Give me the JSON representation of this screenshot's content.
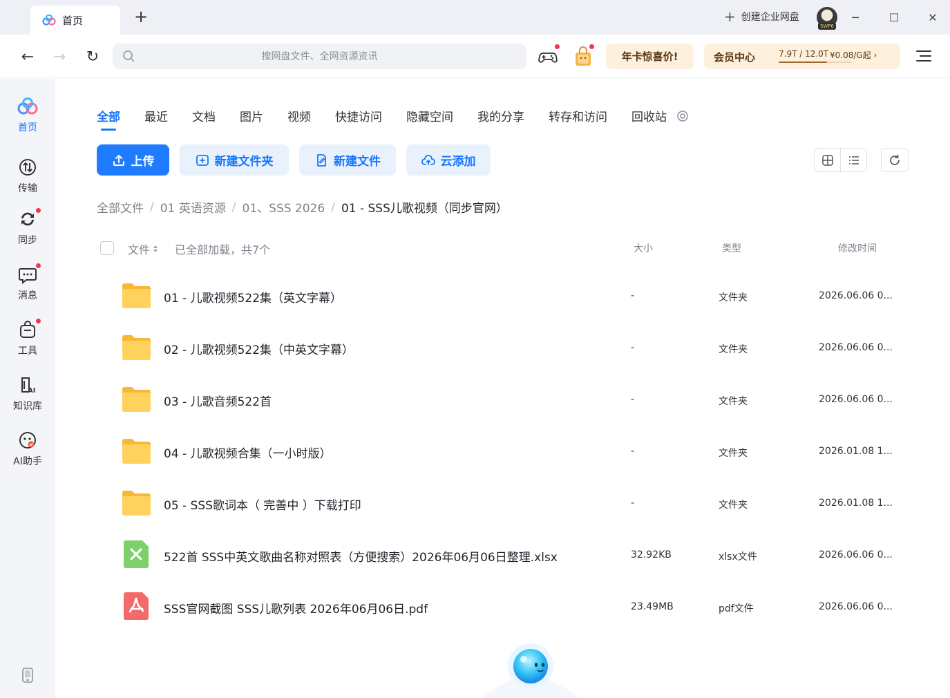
{
  "titlebar": {
    "tab_label": "首页",
    "new_tab": "+",
    "enterprise_label": "创建企业网盘",
    "avatar_badge": "SWP6",
    "minimize": "─",
    "maximize": "☐",
    "close": "✕"
  },
  "toolbar": {
    "back": "←",
    "forward": "→",
    "reload": "↻",
    "search_placeholder": "搜网盘文件、全网资源资讯",
    "promo_label": "年卡惊喜价!",
    "vip": {
      "title": "会员中心",
      "storage": "7.9T / 12.0T",
      "price": "¥0.08/G起",
      "arrow": "›",
      "storage_used_fraction": 0.66
    }
  },
  "sidebar": {
    "items": [
      {
        "label": "首页",
        "icon": "home-logo-icon",
        "active": true,
        "dot": false
      },
      {
        "label": "传输",
        "icon": "transfer-icon",
        "active": false,
        "dot": false
      },
      {
        "label": "同步",
        "icon": "sync-icon",
        "active": false,
        "dot": true
      },
      {
        "label": "消息",
        "icon": "message-icon",
        "active": false,
        "dot": true
      },
      {
        "label": "工具",
        "icon": "tools-icon",
        "active": false,
        "dot": true
      },
      {
        "label": "知识库",
        "icon": "knowledge-base-icon",
        "active": false,
        "dot": false
      },
      {
        "label": "AI助手",
        "icon": "ai-assistant-icon",
        "active": false,
        "dot": false
      }
    ]
  },
  "category_tabs": [
    "全部",
    "最近",
    "文档",
    "图片",
    "视频",
    "快捷访问",
    "隐藏空间",
    "我的分享",
    "转存和访问",
    "回收站"
  ],
  "actions": {
    "upload": "上传",
    "new_folder": "新建文件夹",
    "new_file": "新建文件",
    "cloud_add": "云添加"
  },
  "breadcrumb": [
    "全部文件",
    "01 英语资源",
    "01、SSS 2026",
    "01 - SSS儿歌视频（同步官网）"
  ],
  "breadcrumb_sep": "/",
  "list": {
    "col_name": "文件",
    "status": "已全部加载，共7个",
    "col_size": "大小",
    "col_type": "类型",
    "col_mtime": "修改时间",
    "rows": [
      {
        "name": "01 - 儿歌视频522集（英文字幕）",
        "size": "-",
        "type": "文件夹",
        "mtime": "2026.06.06 0...",
        "kind": "folder"
      },
      {
        "name": "02 - 儿歌视频522集（中英文字幕）",
        "size": "-",
        "type": "文件夹",
        "mtime": "2026.06.06 0...",
        "kind": "folder"
      },
      {
        "name": "03 - 儿歌音频522首",
        "size": "-",
        "type": "文件夹",
        "mtime": "2026.06.06 0...",
        "kind": "folder"
      },
      {
        "name": "04 - 儿歌视频合集（一小时版）",
        "size": "-",
        "type": "文件夹",
        "mtime": "2026.01.08 1...",
        "kind": "folder"
      },
      {
        "name": "05 - SSS歌词本（ 完善中 ）下载打印",
        "size": "-",
        "type": "文件夹",
        "mtime": "2026.01.08 1...",
        "kind": "folder"
      },
      {
        "name": "522首 SSS中英文歌曲名称对照表（方便搜索）2026年06月06日整理.xlsx",
        "size": "32.92KB",
        "type": "xlsx文件",
        "mtime": "2026.06.06 0...",
        "kind": "xlsx"
      },
      {
        "name": "SSS官网截图 SSS儿歌列表 2026年06月06日.pdf",
        "size": "23.49MB",
        "type": "pdf文件",
        "mtime": "2026.06.06 0...",
        "kind": "pdf"
      }
    ]
  },
  "colors": {
    "accent": "#1677ff",
    "folder": "#ffc94d",
    "xlsx": "#7ed06a",
    "pdf": "#f46a6a",
    "badge_red": "#f5334f",
    "promo_bg": "#fdf1de"
  }
}
